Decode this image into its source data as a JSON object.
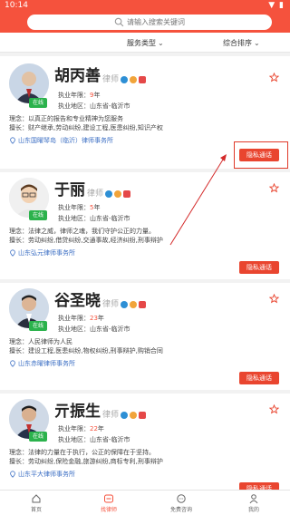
{
  "status": {
    "time": "10:14"
  },
  "search": {
    "placeholder": "请输入搜索关键词"
  },
  "filters": {
    "service_type": "服务类型",
    "sort": "综合排序"
  },
  "labels": {
    "years_label": "执业年限：",
    "years_unit": "年",
    "region_label": "执业地区：",
    "idea_label": "理念：",
    "expertise_label": "擅长：",
    "online": "在线",
    "call": "隐私通话"
  },
  "lawyers": [
    {
      "name": "胡丙善",
      "title": "律师",
      "years": "9",
      "region": "山东省-临沂市",
      "idea": "以真正的报告和专业精神为您服务",
      "expertise": "财产继承,劳动纠纷,建设工程,医患纠纷,知识产权",
      "firm": "山东国曜琴岛（临沂）律师事务所"
    },
    {
      "name": "于丽",
      "title": "律师",
      "years": "5",
      "region": "山东省-临沂市",
      "idea": "法律之威，律师之魂，我们守护公正的力量。",
      "expertise": "劳动纠纷,借贷纠纷,交通事故,经济纠纷,刑事辩护",
      "firm": "山东弘元律师事务所"
    },
    {
      "name": "谷圣晓",
      "title": "律师",
      "years": "23",
      "region": "山东省-临沂市",
      "idea": "人民律师为人民",
      "expertise": "建设工程,医患纠纷,物权纠纷,刑事辩护,购销合同",
      "firm": "山东赤曜律师事务所"
    },
    {
      "name": "亓振生",
      "title": "律师",
      "years": "22",
      "region": "山东省-临沂市",
      "idea": "法律的力量在于执行，公正的保障在于坚持。",
      "expertise": "劳动纠纷,保险金融,旅游纠纷,商标专利,刑事辩护",
      "firm": "山东平大律师事务所"
    }
  ],
  "tabs": [
    {
      "label": "首页",
      "icon": "home-icon"
    },
    {
      "label": "找律师",
      "icon": "lawyer-icon"
    },
    {
      "label": "免费咨询",
      "icon": "chat-icon"
    },
    {
      "label": "我的",
      "icon": "user-icon"
    }
  ],
  "colors": {
    "brand": "#f5523d",
    "online": "#2bb24c",
    "firm_link": "#3c6fc4"
  }
}
